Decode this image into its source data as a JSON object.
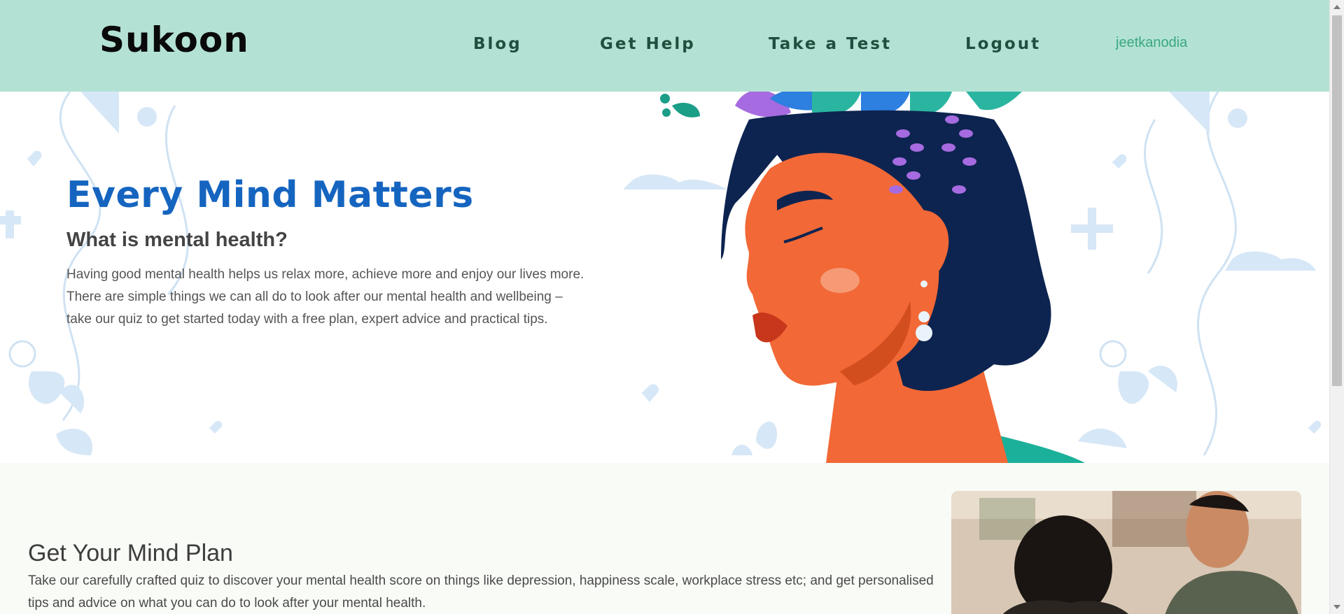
{
  "nav": {
    "brand": "Sukoon",
    "links": [
      "Blog",
      "Get Help",
      "Take a Test",
      "Logout"
    ],
    "username": "jeetkanodia"
  },
  "hero": {
    "title": "Every Mind Matters",
    "subtitle": "What is mental health?",
    "text": "Having good mental health helps us relax more, achieve more and enjoy our lives more. There are simple things we can all do to look after our mental health and wellbeing – take our quiz to get started today with a free plan, expert advice and practical tips."
  },
  "plan": {
    "title": "Get Your Mind Plan",
    "text": "Take our carefully crafted quiz to discover your mental health score on things like depression, happiness scale, workplace stress etc; and get personalised tips and advice on what you can do to look after your mental health."
  },
  "colors": {
    "navbar": "#b3e2d5",
    "hero_title": "#1565c0",
    "nav_link": "#1f4f3e",
    "username": "#3aa77f",
    "plan_bg": "#f8fbf6"
  }
}
